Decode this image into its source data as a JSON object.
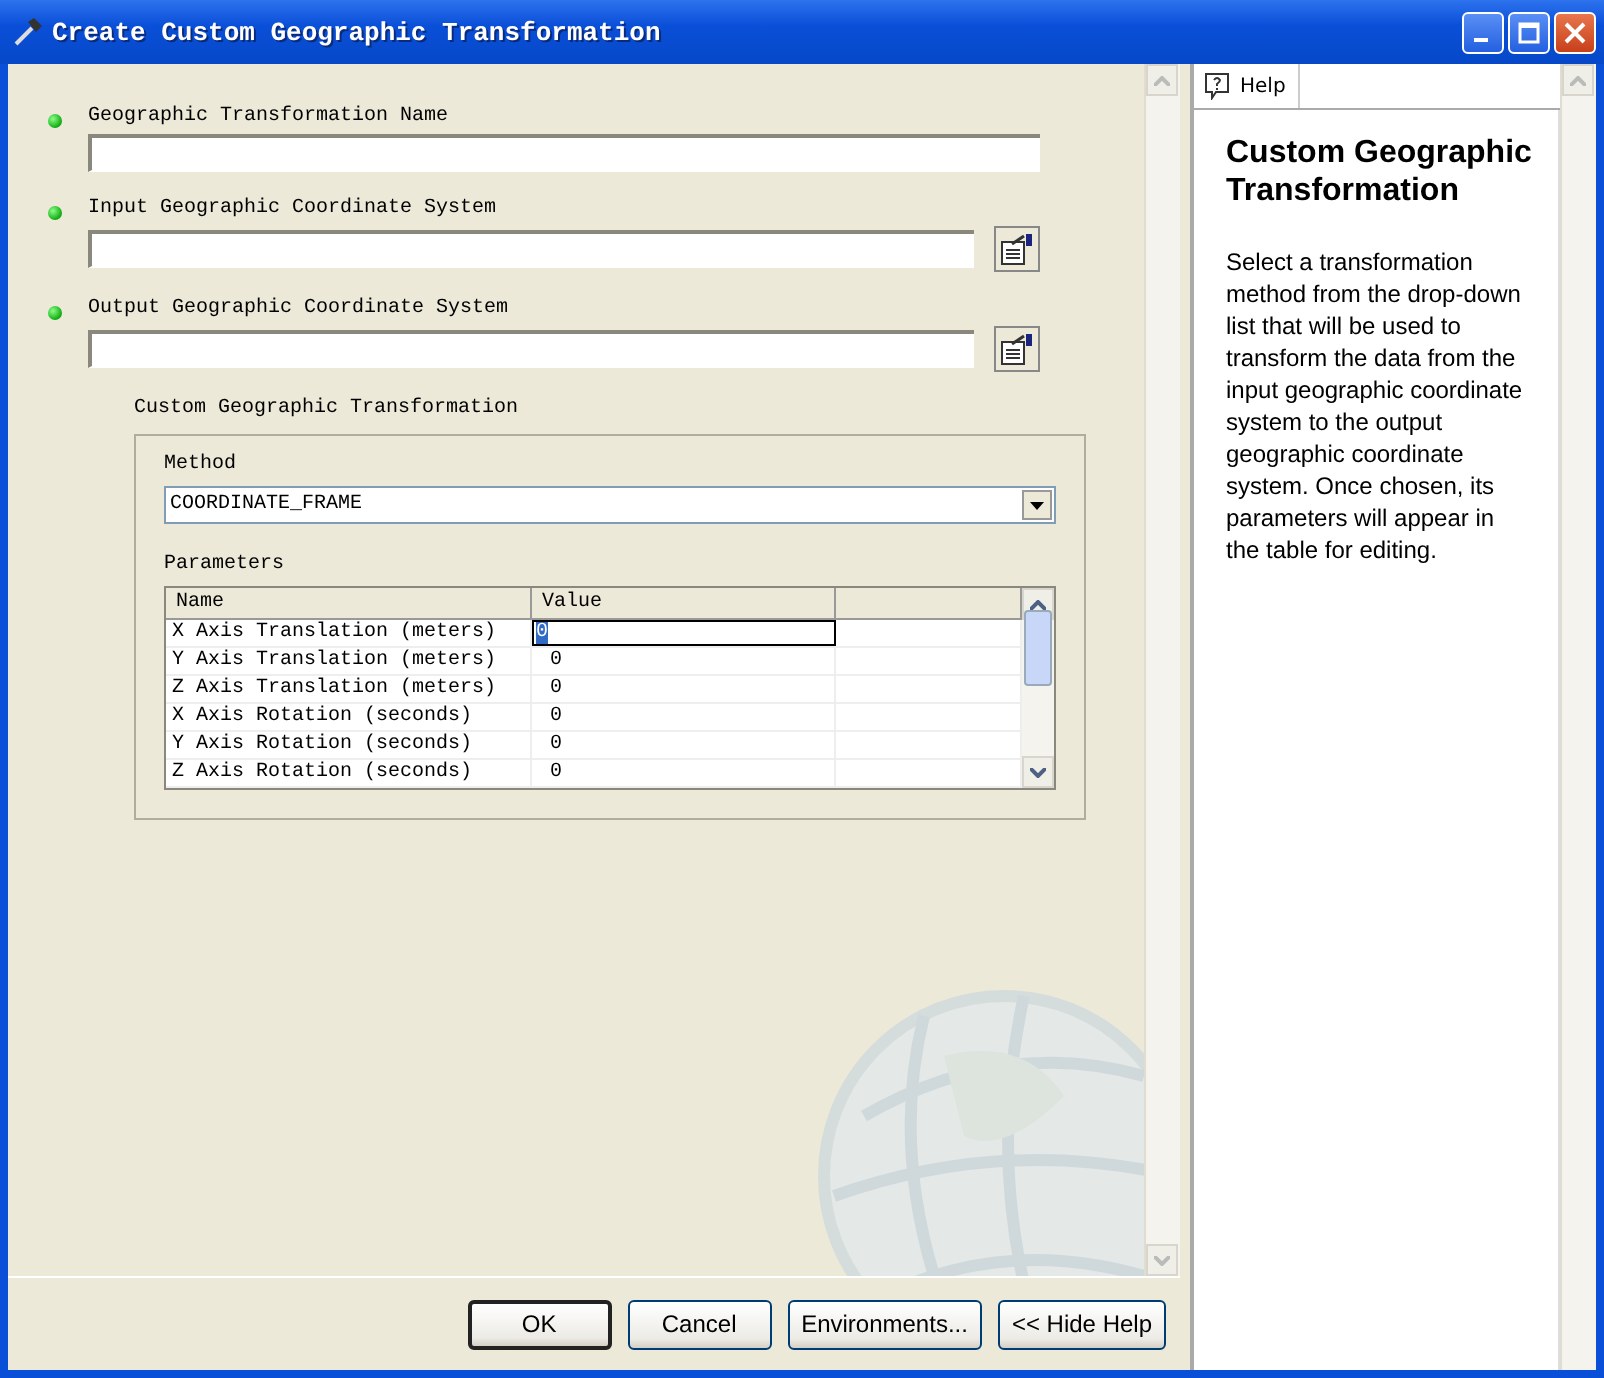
{
  "window": {
    "title": "Create Custom Geographic Transformation"
  },
  "fields": [
    {
      "label": "Geographic Transformation Name",
      "required": true,
      "browse": false
    },
    {
      "label": "Input Geographic Coordinate System",
      "required": true,
      "browse": true
    },
    {
      "label": "Output Geographic Coordinate System",
      "required": true,
      "browse": true
    }
  ],
  "group": {
    "title": "Custom Geographic Transformation",
    "method_label": "Method",
    "method": "COORDINATE_FRAME",
    "parameters_label": "Parameters",
    "columns": [
      "Name",
      "Value"
    ],
    "rows": [
      {
        "name": "X Axis Translation (meters)",
        "value": "0",
        "selected": true
      },
      {
        "name": "Y Axis Translation (meters)",
        "value": "0",
        "selected": false
      },
      {
        "name": "Z Axis Translation (meters)",
        "value": "0",
        "selected": false
      },
      {
        "name": "X Axis Rotation (seconds)",
        "value": "0",
        "selected": false
      },
      {
        "name": "Y Axis Rotation (seconds)",
        "value": "0",
        "selected": false
      },
      {
        "name": "Z Axis Rotation (seconds)",
        "value": "0",
        "selected": false
      }
    ]
  },
  "buttons": [
    {
      "label": "OK",
      "default": true
    },
    {
      "label": "Cancel",
      "default": false
    },
    {
      "label": "Environments...",
      "default": false
    },
    {
      "label": "<< Hide Help",
      "default": false
    }
  ],
  "help": {
    "tab": "Help",
    "title": "Custom Geographic Transformation",
    "body": "Select a transformation method from the drop-down list that will be used to transform the data from the input geographic coordinate system to the output geographic coordinate system. Once chosen, its parameters will appear in the table for editing."
  }
}
